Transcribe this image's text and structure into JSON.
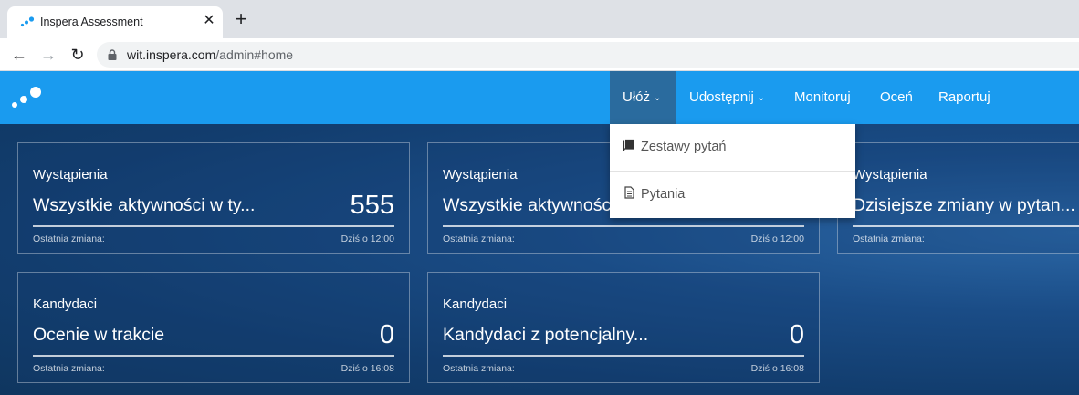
{
  "browser": {
    "tab_title": "Inspera Assessment",
    "tab_close": "✕",
    "new_tab": "+",
    "url_host": "wit.inspera.com",
    "url_path": "/admin#home",
    "back": "←",
    "forward": "→",
    "reload": "↻"
  },
  "nav": {
    "menu": [
      {
        "label": "Ułóż",
        "has_dropdown": true,
        "active": true
      },
      {
        "label": "Udostępnij",
        "has_dropdown": true,
        "active": false
      },
      {
        "label": "Monitoruj",
        "has_dropdown": false,
        "active": false
      },
      {
        "label": "Oceń",
        "has_dropdown": false,
        "active": false
      },
      {
        "label": "Raportuj",
        "has_dropdown": false,
        "active": false
      }
    ],
    "chevron": "⌄",
    "dropdown_items": [
      {
        "label": "Zestawy pytań",
        "icon": "book-icon"
      },
      {
        "label": "Pytania",
        "icon": "document-icon"
      }
    ]
  },
  "cards": [
    {
      "category": "Wystąpienia",
      "title": "Wszystkie aktywności w ty...",
      "value": "555",
      "footer_label": "Ostatnia zmiana:",
      "footer_time": "Dziś o 12:00"
    },
    {
      "category": "Wystąpienia",
      "title": "Wszystkie aktywności",
      "value": "",
      "footer_label": "Ostatnia zmiana:",
      "footer_time": "Dziś o 12:00"
    },
    {
      "category": "Wystąpienia",
      "title": "Dzisiejsze zmiany w pytan...",
      "value": "",
      "footer_label": "Ostatnia zmiana:",
      "footer_time": ""
    },
    {
      "category": "Kandydaci",
      "title": "Ocenie w trakcie",
      "value": "0",
      "footer_label": "Ostatnia zmiana:",
      "footer_time": "Dziś o 16:08"
    },
    {
      "category": "Kandydaci",
      "title": "Kandydaci z potencjalny...",
      "value": "0",
      "footer_label": "Ostatnia zmiana:",
      "footer_time": "Dziś o 16:08"
    }
  ],
  "colors": {
    "header_blue": "#1a9bef",
    "active_menu": "#2a6b9e",
    "background_navy": "#123d6e"
  }
}
